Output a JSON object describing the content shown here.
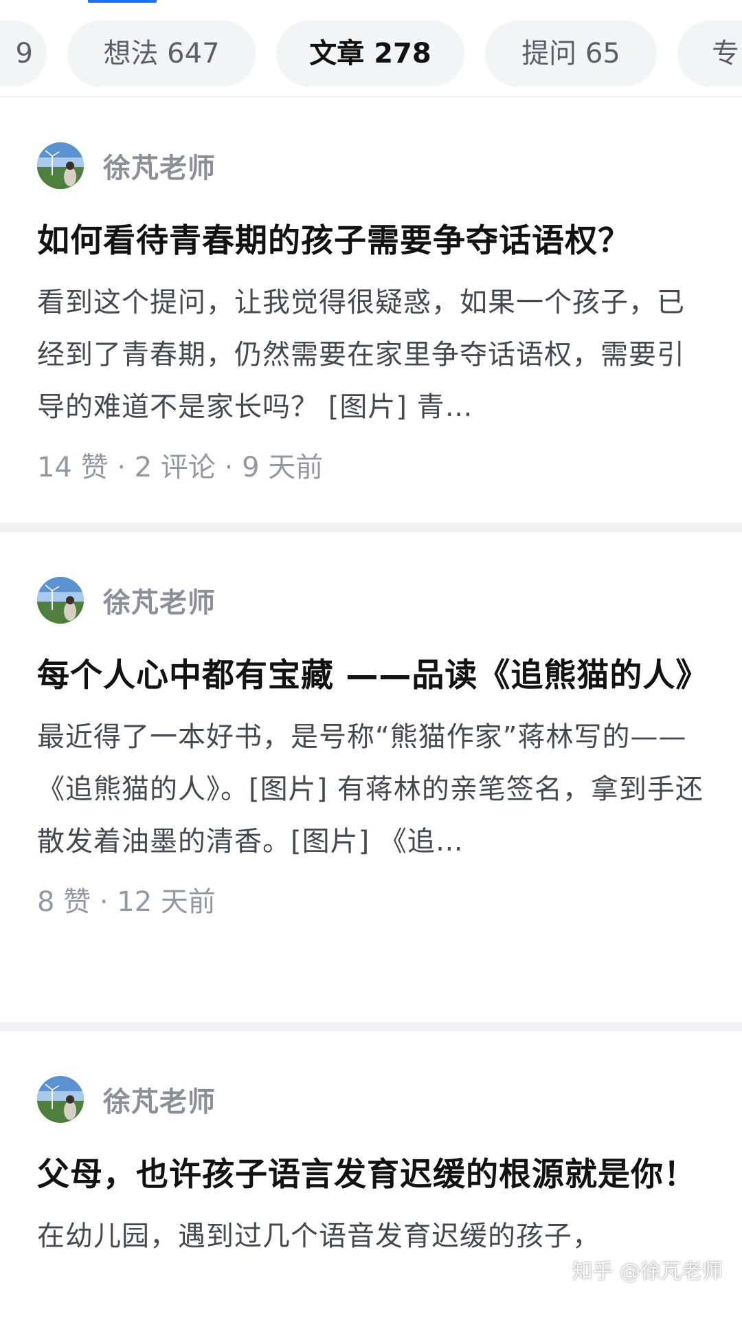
{
  "tabs": [
    {
      "label": "9",
      "active": false
    },
    {
      "label": "想法 647",
      "active": false
    },
    {
      "label": "文章 278",
      "active": true
    },
    {
      "label": "提问 65",
      "active": false
    },
    {
      "label": "专",
      "active": false
    }
  ],
  "colors": {
    "accent": "#1772f6",
    "tab_bg": "#f3f4f6",
    "separator": "#f0f2f5",
    "author": "#8a8f99",
    "meta": "#9399a3"
  },
  "articles": [
    {
      "author": "徐芃老师",
      "avatar_icon": "wind-turbine-avatar",
      "title": "如何看待青春期的孩子需要争夺话语权？",
      "excerpt": "看到这个提问，让我觉得很疑惑，如果一个孩子，已经到了青春期，仍然需要在家里争夺话语权，需要引导的难道不是家长吗？ [图片] 青…",
      "meta": "14 赞 · 2 评论 · 9 天前"
    },
    {
      "author": "徐芃老师",
      "avatar_icon": "wind-turbine-avatar",
      "title": "每个人心中都有宝藏 ——品读《追熊猫的人》",
      "excerpt": "最近得了一本好书，是号称“熊猫作家”蒋林写的——《追熊猫的人》。[图片] 有蒋林的亲笔签名，拿到手还散发着油墨的清香。[图片] 《追…",
      "meta": "8 赞 · 12 天前"
    },
    {
      "author": "徐芃老师",
      "avatar_icon": "wind-turbine-avatar",
      "title": "父母，也许孩子语言发育迟缓的根源就是你！",
      "excerpt": "在幼儿园，遇到过几个语音发育迟缓的孩子，",
      "meta": ""
    }
  ],
  "watermark": "知乎 @徐芃老师"
}
